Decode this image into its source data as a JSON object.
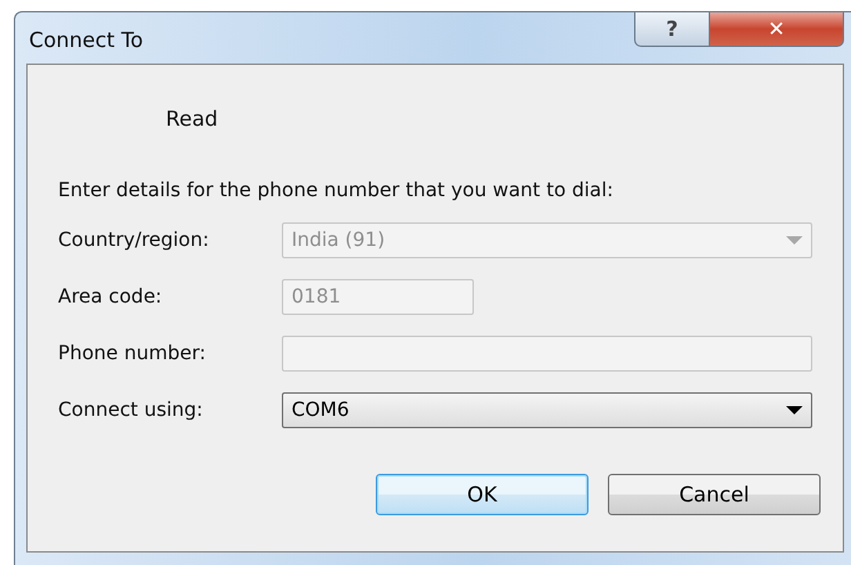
{
  "window": {
    "title": "Connect To",
    "controls": [
      "?",
      "✕"
    ]
  },
  "heading": "Read",
  "instruction": "Enter details for the phone number that you want to dial:",
  "fields": [
    {
      "label": "Country/region:",
      "kind": "dropdown",
      "value": "India (91)",
      "disabled": true
    },
    {
      "label": "Area code:",
      "kind": "code",
      "value": "0181",
      "disabled": true
    },
    {
      "label": "Phone number:",
      "kind": "text",
      "disabled": true
    },
    {
      "label": "Connect using:",
      "kind": "dropdown",
      "value": "COM6",
      "disabled": false
    }
  ],
  "buttons": [
    {
      "label": "OK",
      "default": true
    },
    {
      "label": "Cancel",
      "default": false
    }
  ]
}
